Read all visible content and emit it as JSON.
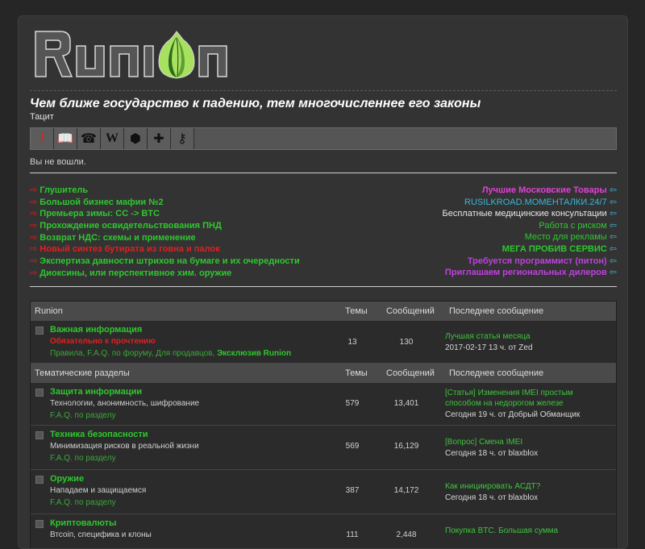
{
  "header": {
    "logo_text": "Runion",
    "slogan": "Чем ближе государство к падению, тем многочисленнее его законы",
    "author": "Тацит",
    "status": "Вы не вошли."
  },
  "iconbar": [
    {
      "name": "alert-icon",
      "glyph": "!"
    },
    {
      "name": "book-icon",
      "glyph": "📖"
    },
    {
      "name": "phone-icon",
      "glyph": "☎"
    },
    {
      "name": "wiki-icon",
      "glyph": "W"
    },
    {
      "name": "cube-icon",
      "glyph": "⬢"
    },
    {
      "name": "add-user-icon",
      "glyph": "✚"
    },
    {
      "name": "key-icon",
      "glyph": "⚷"
    }
  ],
  "links_left": [
    {
      "text": "Глушитель",
      "color": "#2ec82e"
    },
    {
      "text": "Большой бизнес мафии №2",
      "color": "#2ec82e"
    },
    {
      "text": "Премьера зимы: CC -> BTC",
      "color": "#2ec82e"
    },
    {
      "text": "Прохождение освидетельствования ПНД",
      "color": "#2ec82e"
    },
    {
      "text": "Возврат НДС: схемы и применение",
      "color": "#2ec82e"
    },
    {
      "text": "Новый синтез бутирата из говна и палок",
      "color": "#e02020"
    },
    {
      "text": "Экспертиза давности штрихов на бумаге и их очередности",
      "color": "#2ec82e"
    },
    {
      "text": "Диоксины, или перспективное хим. оружие",
      "color": "#2ec82e"
    }
  ],
  "links_right": [
    {
      "text": "Лучшие Московские Товары",
      "color": "#e040d8",
      "bold": true
    },
    {
      "text": "RUSILKROAD.MOMEНТАЛКИ.24/7",
      "color": "#38b8d8",
      "bold": false
    },
    {
      "text": "Бесплатные медицинские консультации",
      "color": "#e8e8e8",
      "bold": false
    },
    {
      "text": "Работа с риском",
      "color": "#2ec82e",
      "bold": false
    },
    {
      "text": "Место для рекламы",
      "color": "#2ec82e",
      "bold": false
    },
    {
      "text": "МЕГА ПРОБИВ СЕРВИС",
      "color": "#2ec82e",
      "bold": true
    },
    {
      "text": "Требуется программист (питон)",
      "color": "#c040e0",
      "bold": true
    },
    {
      "text": "Приглашаем региональных дилеров",
      "color": "#c040e0",
      "bold": true
    }
  ],
  "link_arrow_left": "⇨",
  "link_arrow_right": "⇦",
  "columns": {
    "topics": "Темы",
    "posts": "Сообщений",
    "last": "Последнее сообщение"
  },
  "categories": [
    {
      "title": "Runion",
      "forums": [
        {
          "name": "Важная информация",
          "desc": "Обязательно к прочтению",
          "desc_color": "#e02020",
          "sub": [
            "Правила",
            "F.A.Q. по форуму",
            "Для продавцов",
            "Эксклюзив Runion"
          ],
          "topics": "13",
          "posts": "130",
          "last_title": "Лучшая статья месяца",
          "last_meta": "2017-02-17 13 ч. от Zed"
        }
      ]
    },
    {
      "title": "Тематические разделы",
      "forums": [
        {
          "name": "Защита информации",
          "desc": "Технологии, анонимность, шифрование",
          "desc_color": "#d0d0d0",
          "sub": [
            "F.A.Q. по разделу"
          ],
          "topics": "579",
          "posts": "13,401",
          "last_title": "[Статья] Изменения IMEI простым способом на недорогом железе",
          "last_meta": "Сегодня 19 ч. от Добрый Обманщик"
        },
        {
          "name": "Техника безопасности",
          "desc": "Минимизация рисков в реальной жизни",
          "desc_color": "#d0d0d0",
          "sub": [
            "F.A.Q. по разделу"
          ],
          "topics": "569",
          "posts": "16,129",
          "last_title": "[Вопрос] Смена IMEI",
          "last_meta": "Сегодня 18 ч. от blaxblox"
        },
        {
          "name": "Оружие",
          "desc": "Нападаем и защищаемся",
          "desc_color": "#d0d0d0",
          "sub": [
            "F.A.Q. по разделу"
          ],
          "topics": "387",
          "posts": "14,172",
          "last_title": "Как инициировать АСДТ?",
          "last_meta": "Сегодня 18 ч. от blaxblox"
        },
        {
          "name": "Криптовалюты",
          "desc": "Втсоіп, специфика и клоны",
          "desc_color": "#d0d0d0",
          "sub": [],
          "topics": "111",
          "posts": "2,448",
          "last_title": "Покупка BTC. Большая сумма",
          "last_meta": ""
        }
      ]
    }
  ]
}
